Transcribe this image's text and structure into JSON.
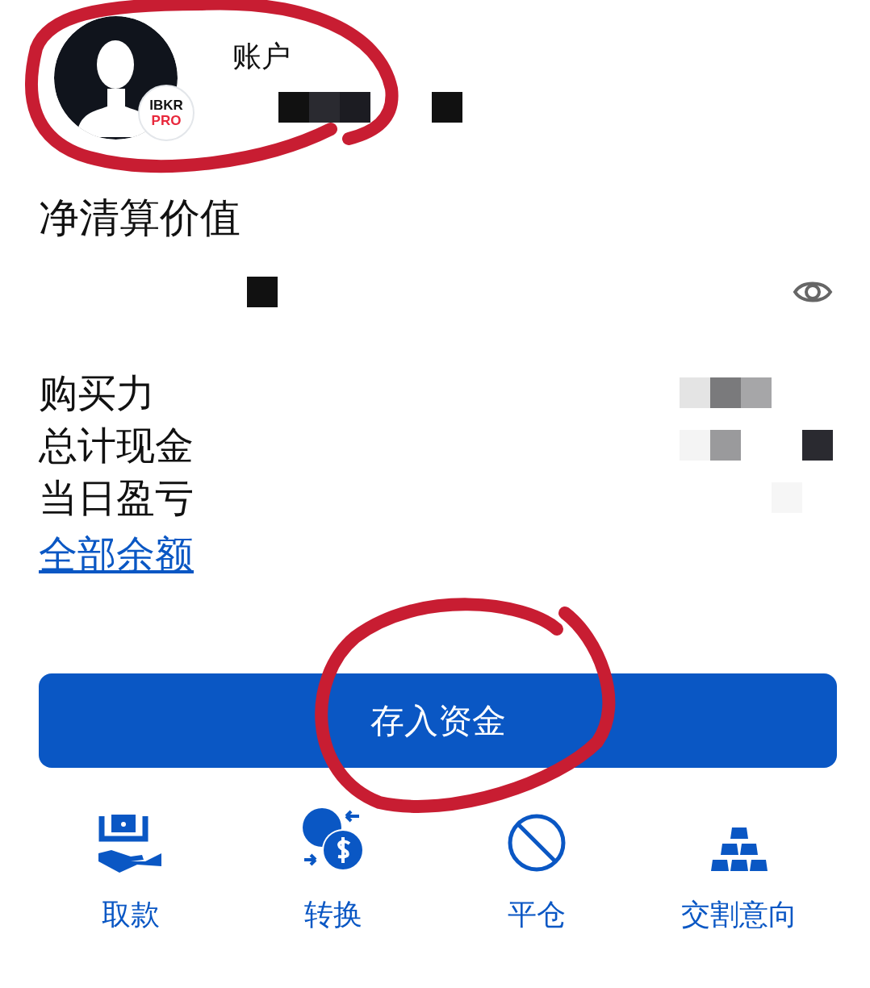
{
  "account": {
    "label": "账户",
    "badge": {
      "line1": "IBKR",
      "line2": "PRO"
    }
  },
  "net_liquidation": {
    "label": "净清算价值"
  },
  "metrics": [
    {
      "label": "购买力"
    },
    {
      "label": "总计现金"
    },
    {
      "label": "当日盈亏"
    }
  ],
  "all_balances_link": "全部余额",
  "deposit_button": "存入资金",
  "actions": [
    {
      "label": "取款",
      "kind": "withdraw"
    },
    {
      "label": "转换",
      "kind": "convert"
    },
    {
      "label": "平仓",
      "kind": "close"
    },
    {
      "label": "交割意向",
      "kind": "delivery"
    }
  ]
}
